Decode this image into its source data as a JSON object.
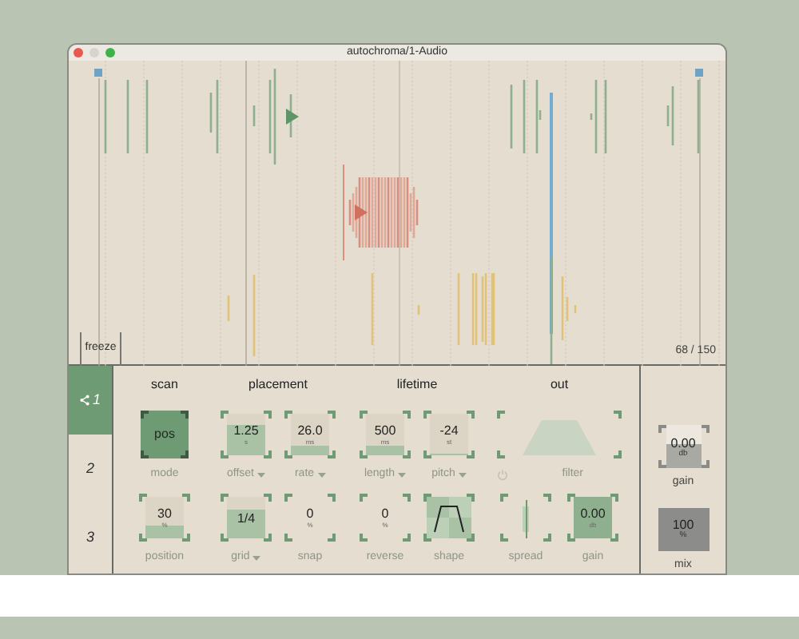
{
  "window": {
    "title": "autochroma/1-Audio"
  },
  "display": {
    "freeze_label": "freeze",
    "counter": "68 / 150"
  },
  "tabs": [
    {
      "label": "1",
      "selected": true
    },
    {
      "label": "2",
      "selected": false
    },
    {
      "label": "3",
      "selected": false
    }
  ],
  "groups": [
    {
      "title": "scan",
      "rows": [
        [
          {
            "kind": "toggle",
            "value": "pos",
            "label": "mode",
            "on": true
          }
        ],
        [
          {
            "kind": "dial",
            "value": "30",
            "unit": "%",
            "level": 0.3,
            "label": "position"
          }
        ]
      ]
    },
    {
      "title": "placement",
      "rows": [
        [
          {
            "kind": "dial",
            "value": "1.25",
            "unit": "s",
            "level": 0.75,
            "label": "offset",
            "menu": true
          },
          {
            "kind": "dial",
            "value": "26.0",
            "unit": "ms",
            "level": 0.25,
            "label": "rate",
            "menu": true
          }
        ],
        [
          {
            "kind": "dial",
            "value": "1/4",
            "level": 0.7,
            "label": "grid",
            "menu": true
          },
          {
            "kind": "dial",
            "value": "0",
            "unit": "%",
            "label": "snap"
          }
        ]
      ]
    },
    {
      "title": "lifetime",
      "rows": [
        [
          {
            "kind": "dial",
            "value": "500",
            "unit": "ms",
            "level": 0.25,
            "label": "length",
            "menu": true
          },
          {
            "kind": "dial",
            "value": "-24",
            "unit": "st",
            "level": 0.05,
            "label": "pitch",
            "menu": true
          }
        ],
        [
          {
            "kind": "dial",
            "value": "0",
            "unit": "%",
            "label": "reverse"
          },
          {
            "kind": "shape",
            "label": "shape"
          }
        ]
      ]
    },
    {
      "title": "out",
      "rows": [
        [
          {
            "kind": "filter",
            "label": "filter"
          }
        ],
        [
          {
            "kind": "spread",
            "label": "spread"
          },
          {
            "kind": "dial",
            "value": "0.00",
            "unit": "db",
            "level": 1,
            "label": "gain"
          }
        ]
      ]
    }
  ],
  "master": [
    {
      "kind": "grey",
      "value": "0.00",
      "unit": "db",
      "level": 0.55,
      "label": "gain"
    },
    {
      "kind": "dark",
      "value": "100",
      "unit": "%",
      "level": 1,
      "label": "mix"
    }
  ]
}
